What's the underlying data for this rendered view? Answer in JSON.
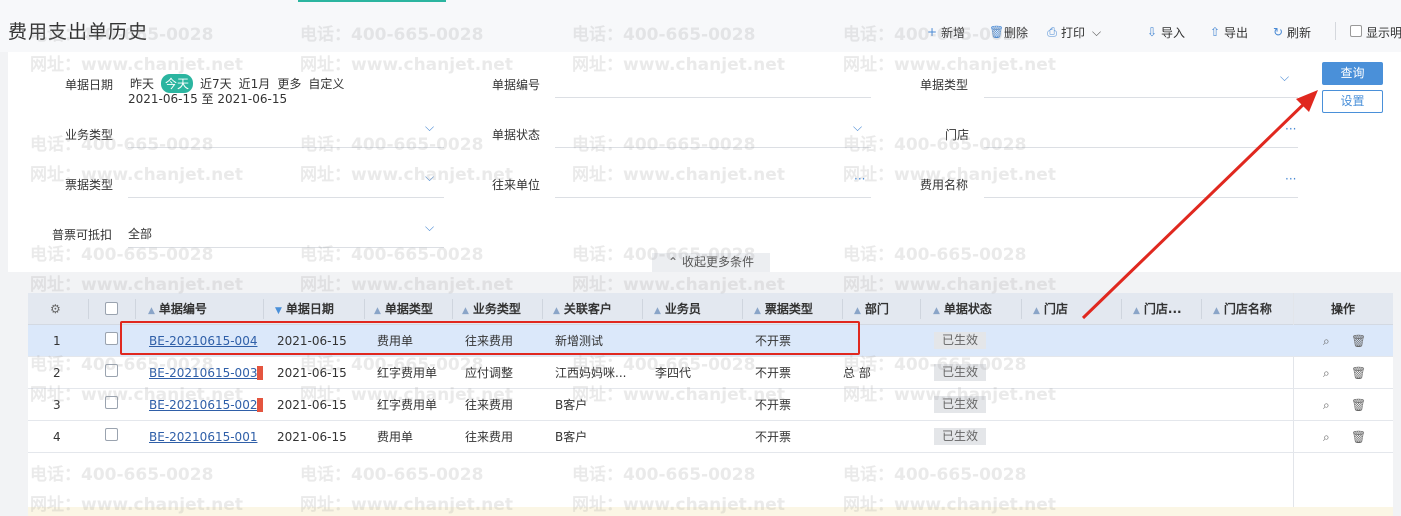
{
  "page": {
    "title": "费用支出单历史"
  },
  "toolbar": {
    "new_label": "新增",
    "delete_label": "删除",
    "print_label": "打印",
    "import_label": "导入",
    "export_label": "导出",
    "refresh_label": "刷新",
    "show_label": "显示明"
  },
  "filters": {
    "date_label": "单据日期",
    "date_options": [
      "昨天",
      "今天",
      "近7天",
      "近1月",
      "更多",
      "自定义"
    ],
    "date_range": "2021-06-15 至 2021-06-15",
    "doc_no_label": "单据编号",
    "doc_type_label": "单据类型",
    "biz_type_label": "业务类型",
    "doc_status_label": "单据状态",
    "store_label": "门店",
    "invoice_type_label": "票据类型",
    "partner_label": "往来单位",
    "expense_name_label": "费用名称",
    "deductible_label": "普票可抵扣",
    "deductible_value": "全部",
    "collapse_label": "收起更多条件",
    "query_label": "查询",
    "settings_label": "设置"
  },
  "grid": {
    "headers": [
      "单据编号",
      "单据日期",
      "单据类型",
      "业务类型",
      "关联客户",
      "业务员",
      "票据类型",
      "部门",
      "单据状态",
      "门店",
      "门店...",
      "门店名称",
      "操作"
    ],
    "rows": [
      {
        "idx": "1",
        "doc_no": "BE-20210615-004",
        "date": "2021-06-15",
        "doc_type": "费用单",
        "biz_type": "往来费用",
        "customer": "新增测试",
        "salesman": "",
        "invoice": "不开票",
        "dept": "",
        "status": "已生效"
      },
      {
        "idx": "2",
        "doc_no": "BE-20210615-003",
        "date": "2021-06-15",
        "doc_type": "红字费用单",
        "biz_type": "应付调整",
        "customer": "江西妈妈咪...",
        "salesman": "李四代",
        "invoice": "不开票",
        "dept": "总 部",
        "status": "已生效"
      },
      {
        "idx": "3",
        "doc_no": "BE-20210615-002",
        "date": "2021-06-15",
        "doc_type": "红字费用单",
        "biz_type": "往来费用",
        "customer": "B客户",
        "salesman": "",
        "invoice": "不开票",
        "dept": "",
        "status": "已生效"
      },
      {
        "idx": "4",
        "doc_no": "BE-20210615-001",
        "date": "2021-06-15",
        "doc_type": "费用单",
        "biz_type": "往来费用",
        "customer": "B客户",
        "salesman": "",
        "invoice": "不开票",
        "dept": "",
        "status": "已生效"
      }
    ]
  },
  "watermark": {
    "phone": "电话：400-665-0028",
    "site": "网址：www.chanjet.net"
  },
  "colors": {
    "accent": "#2bb5a0",
    "primary": "#4a90d9",
    "annotation": "#e0281f"
  }
}
